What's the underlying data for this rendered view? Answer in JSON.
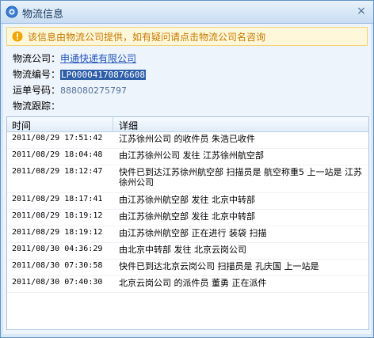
{
  "window": {
    "title": "物流信息",
    "close_glyph": "×"
  },
  "notice": {
    "text": "该信息由物流公司提供，如有疑问请点击物流公司名咨询",
    "icon": "warning-icon"
  },
  "info": {
    "company_label": "物流公司：",
    "company_value": "申通快递有限公司",
    "logistics_no_label": "物流编号：",
    "logistics_no_value": "LP00004170876608",
    "waybill_label": "运单号码：",
    "waybill_value": "888080275797",
    "tracking_label": "物流跟踪："
  },
  "table": {
    "col_time": "时间",
    "col_detail": "详细",
    "rows": [
      {
        "time": "2011/08/29 17:51:42",
        "detail": "江苏徐州公司 的收件员 朱浩已收件"
      },
      {
        "time": "2011/08/29 18:04:48",
        "detail": "由江苏徐州公司 发往 江苏徐州航空部"
      },
      {
        "time": "2011/08/29 18:12:47",
        "detail": "快件已到达江苏徐州航空部 扫描员是 航空称重5 上一站是 江苏徐州公司"
      },
      {
        "time": "2011/08/29 18:17:41",
        "detail": "由江苏徐州航空部 发往 北京中转部"
      },
      {
        "time": "2011/08/29 18:19:12",
        "detail": "由江苏徐州航空部 发往 北京中转部"
      },
      {
        "time": "2011/08/29 18:19:12",
        "detail": "由江苏徐州航空部 正在进行 装袋 扫描"
      },
      {
        "time": "2011/08/30 04:36:29",
        "detail": "由北京中转部 发往 北京云岗公司"
      },
      {
        "time": "2011/08/30 07:30:58",
        "detail": "快件已到达北京云岗公司 扫描员是 孔庆国 上一站是"
      },
      {
        "time": "2011/08/30 07:40:30",
        "detail": "北京云岗公司 的派件员 董勇 正在派件"
      }
    ]
  }
}
